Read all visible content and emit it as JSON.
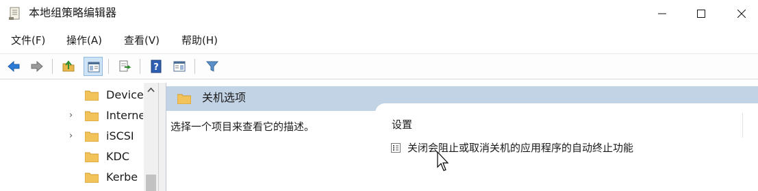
{
  "window": {
    "title": "本地组策略编辑器",
    "controls": [
      "minimize-icon",
      "maximize-icon",
      "close-icon"
    ]
  },
  "menu": {
    "items": [
      {
        "label": "文件(F)"
      },
      {
        "label": "操作(A)"
      },
      {
        "label": "查看(V)"
      },
      {
        "label": "帮助(H)"
      }
    ]
  },
  "toolbar": {
    "buttons": [
      "back-arrow-icon",
      "forward-arrow-icon",
      "up-folder-icon",
      "show-hide-tree-icon",
      "export-list-icon",
      "help-icon",
      "properties-icon",
      "filter-icon"
    ],
    "accent": "#2a7bd5"
  },
  "tree": {
    "items": [
      {
        "label": "Device",
        "expander": ""
      },
      {
        "label": "Interne",
        "expander": "›"
      },
      {
        "label": "iSCSI",
        "expander": "›"
      },
      {
        "label": "KDC",
        "expander": ""
      },
      {
        "label": "Kerbe",
        "expander": ""
      }
    ]
  },
  "right_pane": {
    "header_title": "关机选项",
    "description": "选择一个项目来查看它的描述。",
    "column_header": "设置",
    "settings": [
      {
        "label": "关闭会阻止或取消关机的应用程序的自动终止功能",
        "icon": "policy-setting-icon"
      }
    ],
    "header_color": "#c3d3e6"
  }
}
